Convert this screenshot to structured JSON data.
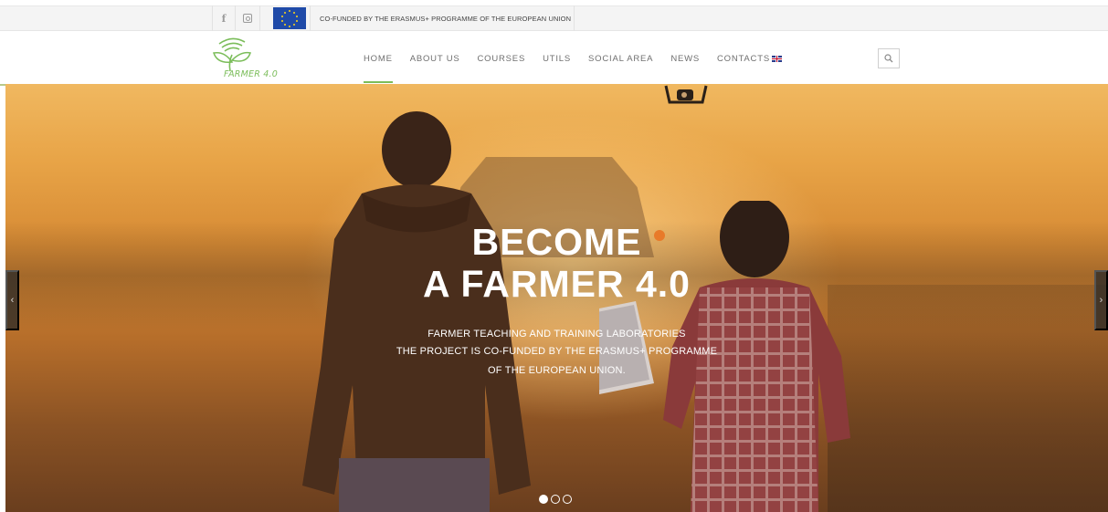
{
  "topbar": {
    "cofunded_text": "CO-FUNDED BY THE ERASMUS+ PROGRAMME OF THE EUROPEAN UNION",
    "facebook_glyph": "f",
    "icons": [
      "facebook-icon",
      "instagram-icon",
      "eu-flag-icon"
    ]
  },
  "brand": {
    "logo_text": "FARMER 4.0",
    "color": "#7bbd5a"
  },
  "nav": {
    "items": [
      {
        "label": "HOME",
        "active": true
      },
      {
        "label": "ABOUT US",
        "active": false
      },
      {
        "label": "COURSES",
        "active": false
      },
      {
        "label": "UTILS",
        "active": false
      },
      {
        "label": "SOCIAL AREA",
        "active": false
      },
      {
        "label": "NEWS",
        "active": false
      },
      {
        "label": "CONTACTS",
        "active": false
      }
    ],
    "language_icon": "uk-flag-icon",
    "search_icon": "search-icon"
  },
  "hero": {
    "title_line1": "BECOME",
    "title_line2": "A FARMER 4.0",
    "sub_line1": "FARMER TEACHING AND TRAINING LABORATORIES",
    "sub_line2": "THE PROJECT IS CO-FUNDED BY THE ERASMUS+ PROGRAMME",
    "sub_line3": "OF THE EUROPEAN UNION.",
    "prev_glyph": "‹",
    "next_glyph": "›",
    "slide_count": 3,
    "active_slide": 1
  },
  "colors": {
    "accent_green": "#7bbd5a",
    "hero_orange": "#e87a2a"
  }
}
